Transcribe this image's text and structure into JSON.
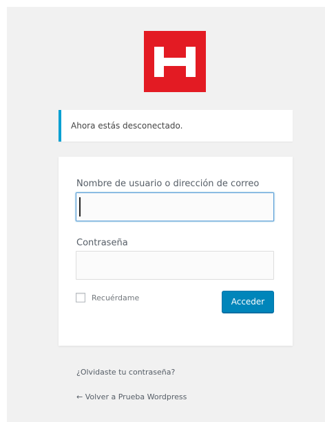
{
  "logo": {
    "icon": "letter-h-logo",
    "color": "#e31b23"
  },
  "notice": {
    "message": "Ahora estás desconectado.",
    "accent_color": "#00a0d2"
  },
  "login_form": {
    "username_label": "Nombre de usuario o dirección de correo",
    "username_value": "",
    "password_label": "Contraseña",
    "password_value": "",
    "remember_label": "Recuérdame",
    "remember_checked": false,
    "submit_label": "Acceder",
    "submit_color": "#0085ba"
  },
  "footer": {
    "lost_password": "¿Olvidaste tu contraseña?",
    "back_to_site": "← Volver a Prueba Wordpress"
  }
}
